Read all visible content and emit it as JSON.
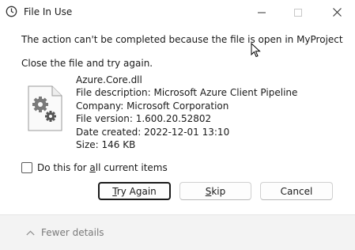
{
  "window": {
    "title": "File In Use",
    "icons": {
      "app": "clock-icon",
      "minimize": "minimize-icon",
      "maximize": "maximize-icon",
      "close": "close-icon"
    }
  },
  "message": {
    "line1": "The action can't be completed because the file is open in MyProject",
    "line2": "Close the file and try again."
  },
  "file": {
    "icon": "settings-file-icon",
    "name": "Azure.Core.dll",
    "description": "File description: Microsoft Azure Client Pipeline",
    "company": "Company: Microsoft Corporation",
    "version": "File version: 1.600.20.52802",
    "date_created": "Date created: 2022-12-01 13:10",
    "size": "Size: 146 KB"
  },
  "checkbox": {
    "label_pre": "Do this for ",
    "label_accel": "a",
    "label_post": "ll current items",
    "checked": false
  },
  "buttons": {
    "try_again": {
      "pre": "",
      "accel": "T",
      "post": "ry Again",
      "default": true
    },
    "skip": {
      "pre": "",
      "accel": "S",
      "post": "kip"
    },
    "cancel": {
      "label": "Cancel"
    }
  },
  "footer": {
    "label": "Fewer details",
    "icon": "chevron-up-icon"
  }
}
